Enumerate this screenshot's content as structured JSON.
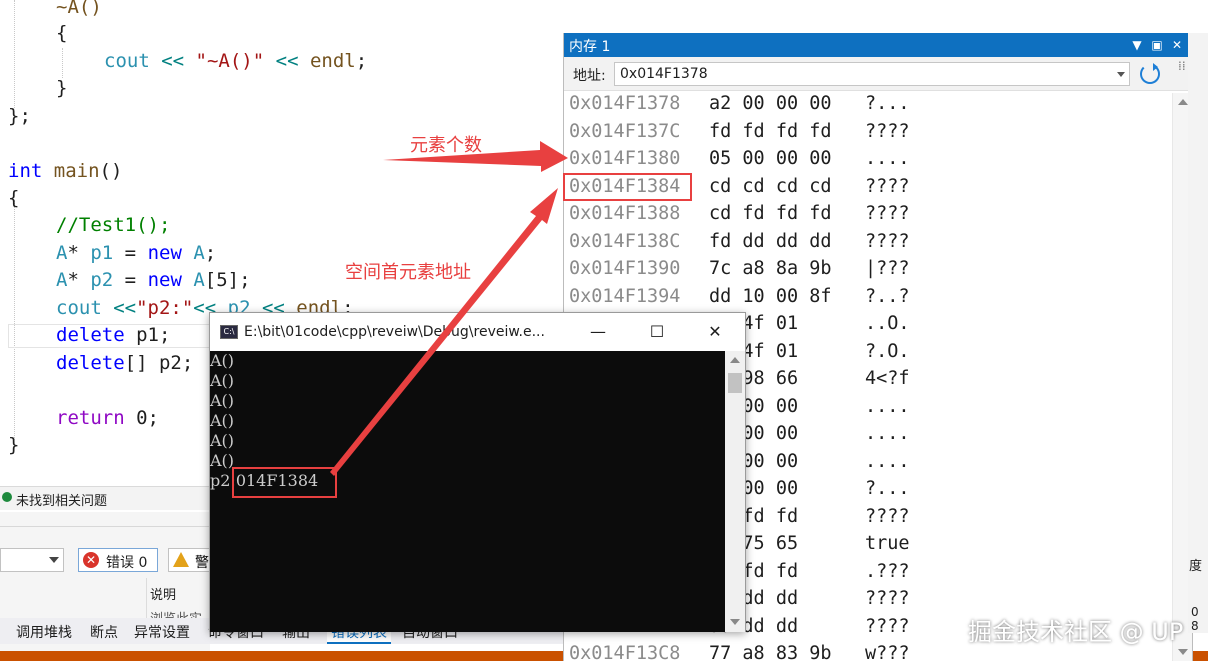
{
  "editor": {
    "lines": [
      {
        "id": "dtor-sig",
        "parts": [
          {
            "t": "~A()",
            "c": "fn"
          }
        ]
      },
      {
        "id": "dtor-open",
        "parts": [
          {
            "t": "{",
            "c": ""
          }
        ]
      },
      {
        "id": "dtor-body",
        "parts": [
          {
            "t": "cout ",
            "c": "ty"
          },
          {
            "t": "<<",
            "c": "op"
          },
          {
            "t": " ",
            "c": ""
          },
          {
            "t": "\"~A()\"",
            "c": "str"
          },
          {
            "t": " ",
            "c": ""
          },
          {
            "t": "<<",
            "c": "op"
          },
          {
            "t": " ",
            "c": ""
          },
          {
            "t": "endl",
            "c": "fn"
          },
          {
            "t": ";",
            "c": ""
          }
        ]
      },
      {
        "id": "dtor-close",
        "parts": [
          {
            "t": "}",
            "c": ""
          }
        ]
      },
      {
        "id": "class-close",
        "parts": [
          {
            "t": "};",
            "c": ""
          }
        ]
      },
      {
        "id": "main-sig",
        "parts": [
          {
            "t": "int",
            "c": "kw"
          },
          {
            "t": " ",
            "c": ""
          },
          {
            "t": "main",
            "c": "fn"
          },
          {
            "t": "()",
            "c": ""
          }
        ]
      },
      {
        "id": "main-open",
        "parts": [
          {
            "t": "{",
            "c": ""
          }
        ]
      },
      {
        "id": "comment",
        "parts": [
          {
            "t": "//Test1();",
            "c": "cm"
          }
        ]
      },
      {
        "id": "new-p1",
        "parts": [
          {
            "t": "A",
            "c": "ty"
          },
          {
            "t": "* ",
            "c": ""
          },
          {
            "t": "p1",
            "c": "ty"
          },
          {
            "t": " = ",
            "c": ""
          },
          {
            "t": "new",
            "c": "kw"
          },
          {
            "t": " ",
            "c": ""
          },
          {
            "t": "A",
            "c": "ty"
          },
          {
            "t": ";",
            "c": ""
          }
        ]
      },
      {
        "id": "new-p2",
        "parts": [
          {
            "t": "A",
            "c": "ty"
          },
          {
            "t": "* ",
            "c": ""
          },
          {
            "t": "p2",
            "c": "ty"
          },
          {
            "t": " = ",
            "c": ""
          },
          {
            "t": "new",
            "c": "kw"
          },
          {
            "t": " ",
            "c": ""
          },
          {
            "t": "A",
            "c": "ty"
          },
          {
            "t": "[5];",
            "c": ""
          }
        ]
      },
      {
        "id": "cout-p2",
        "parts": [
          {
            "t": "cout ",
            "c": "ty"
          },
          {
            "t": "<<",
            "c": "op"
          },
          {
            "t": "\"p2:\"",
            "c": "str"
          },
          {
            "t": "<<",
            "c": "op"
          },
          {
            "t": " p2 ",
            "c": "ty"
          },
          {
            "t": "<<",
            "c": "op"
          },
          {
            "t": " ",
            "c": ""
          },
          {
            "t": "endl",
            "c": "fn"
          },
          {
            "t": ";",
            "c": ""
          }
        ]
      },
      {
        "id": "delete-p1",
        "parts": [
          {
            "t": "delete",
            "c": "kw"
          },
          {
            "t": " p1;",
            "c": ""
          }
        ]
      },
      {
        "id": "delete-p2",
        "parts": [
          {
            "t": "delete",
            "c": "kw"
          },
          {
            "t": "[] p2;",
            "c": ""
          }
        ]
      },
      {
        "id": "blank",
        "parts": [
          {
            "t": "",
            "c": ""
          }
        ]
      },
      {
        "id": "return",
        "parts": [
          {
            "t": "return",
            "c": "ctrl"
          },
          {
            "t": " 0;",
            "c": ""
          }
        ]
      },
      {
        "id": "main-close",
        "parts": [
          {
            "t": "}",
            "c": ""
          }
        ]
      }
    ]
  },
  "status": {
    "no_issues": "未找到相关问题"
  },
  "error_list": {
    "errors_label": "错误 0",
    "warnings_label": "警",
    "column_description": "说明",
    "row_partial": "浏览此实"
  },
  "bottom_tabs": [
    "调用堆栈",
    "断点",
    "异常设置",
    "命令窗口",
    "输出",
    "错误列表",
    "自动窗口"
  ],
  "bottom_active_tab": "错误列表",
  "memory": {
    "title": "内存 1",
    "address_label": "地址:",
    "address_value": "0x014F1378",
    "rows": [
      {
        "addr": "0x014F1378",
        "hex": "a2 00 00 00",
        "chars": "?..."
      },
      {
        "addr": "0x014F137C",
        "hex": "fd fd fd fd",
        "chars": "????"
      },
      {
        "addr": "0x014F1380",
        "hex": "05 00 00 00",
        "chars": "...."
      },
      {
        "addr": "0x014F1384",
        "hex": "cd cd cd cd",
        "chars": "????"
      },
      {
        "addr": "0x014F1388",
        "hex": "cd fd fd fd",
        "chars": "????"
      },
      {
        "addr": "0x014F138C",
        "hex": "fd dd dd dd",
        "chars": "????"
      },
      {
        "addr": "0x014F1390",
        "hex": "7c a8 8a 9b",
        "chars": "|???"
      },
      {
        "addr": "0x014F1394",
        "hex": "dd 10 00 8f",
        "chars": "?..?"
      },
      {
        "addr": "",
        "hex": "14 4f 01",
        "chars": "..O."
      },
      {
        "addr": "",
        "hex": "0d 4f 01",
        "chars": "?.O."
      },
      {
        "addr": "",
        "hex": "3c 98 66",
        "chars": "4<?f"
      },
      {
        "addr": "",
        "hex": "02 00 00",
        "chars": "...."
      },
      {
        "addr": "",
        "hex": "00 00 00",
        "chars": "...."
      },
      {
        "addr": "",
        "hex": "00 00 00",
        "chars": "...."
      },
      {
        "addr": "",
        "hex": "00 00 00",
        "chars": "?..."
      },
      {
        "addr": "",
        "hex": "fd fd fd",
        "chars": "????"
      },
      {
        "addr": "",
        "hex": "72 75 65",
        "chars": "true"
      },
      {
        "addr": "",
        "hex": "fd fd fd",
        "chars": ".???"
      },
      {
        "addr": "",
        "hex": "dd dd dd",
        "chars": "????"
      },
      {
        "addr": "",
        "hex": "dd dd dd",
        "chars": "????"
      },
      {
        "addr": "0x014F13C8",
        "hex": "77 a8 83 9b",
        "chars": "w???"
      }
    ]
  },
  "right_edge": {
    "text1": "度",
    "text2": "0 8"
  },
  "console": {
    "path": "E:\\bit\\01code\\cpp\\reveiw\\Debug\\reveiw.e...",
    "icon_text": "C:\\",
    "lines": [
      "A()",
      "A()",
      "A()",
      "A()",
      "A()",
      "A()",
      "p2:014F1384"
    ]
  },
  "annotations": {
    "element_count": "元素个数",
    "first_element_addr": "空间首元素地址"
  },
  "watermark": "掘金技术社区 @ UP",
  "colors": {
    "accent": "#0e70c0",
    "annotation": "#e84040",
    "console_bg": "#0c0c0c"
  }
}
